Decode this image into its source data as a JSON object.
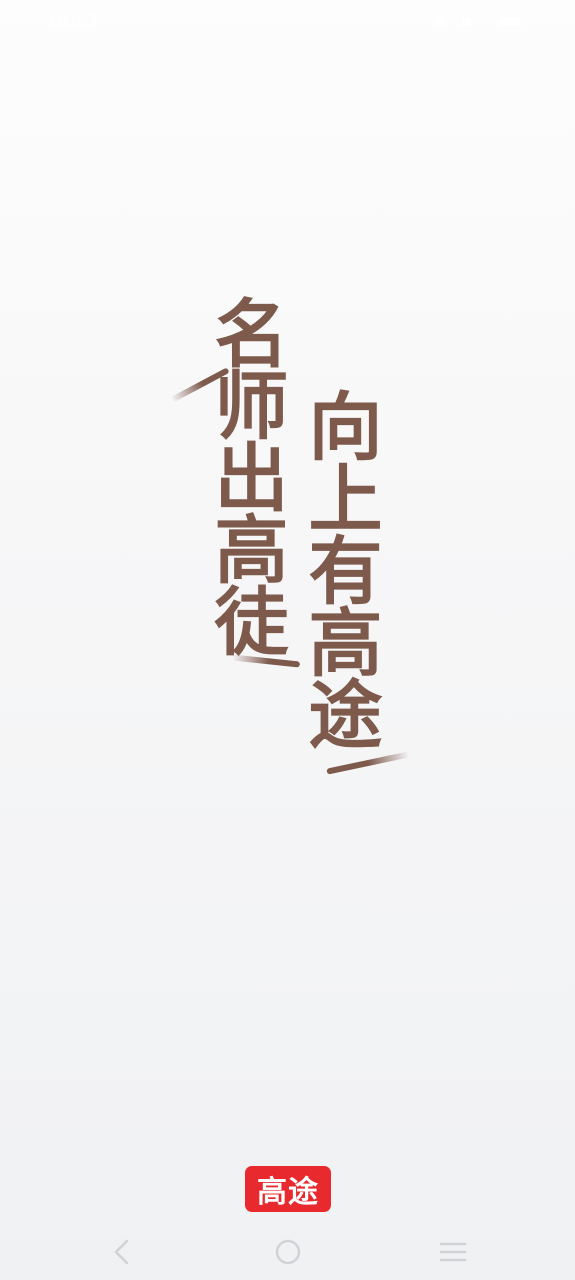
{
  "status_bar": {
    "time": "18:57",
    "icon_color": "#ffffff"
  },
  "slogan": {
    "left_column": "名师出高徒",
    "right_column": "向上有高途",
    "color": "#7d5a4c"
  },
  "logo": {
    "text": "高途",
    "background": "#e8292d"
  },
  "navigation": {
    "back_icon": "back-chevron-icon",
    "home_icon": "home-circle-icon",
    "menu_icon": "menu-lines-icon",
    "icon_color": "#d0d2d6"
  }
}
